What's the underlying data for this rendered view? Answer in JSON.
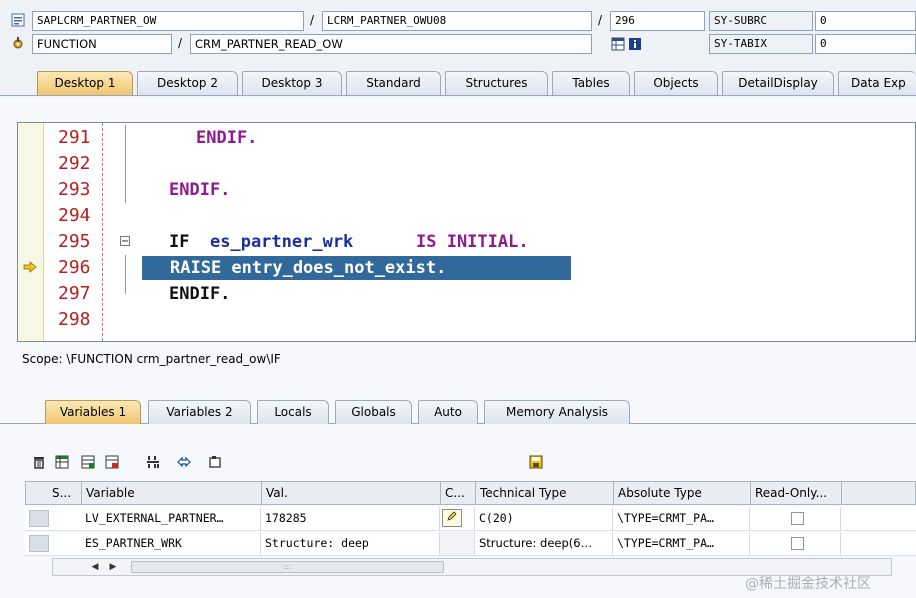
{
  "header": {
    "row1": {
      "program": "SAPLCRM_PARTNER_OW",
      "include": "LCRM_PARTNER_OWU08",
      "line": "296",
      "sy_label": "SY-SUBRC",
      "sy_value": "0"
    },
    "row2": {
      "type": "FUNCTION",
      "name": "CRM_PARTNER_READ_OW",
      "sy_label": "SY-TABIX",
      "sy_value": "0"
    },
    "slash": "/"
  },
  "tabs": [
    "Desktop 1",
    "Desktop 2",
    "Desktop 3",
    "Standard",
    "Structures",
    "Tables",
    "Objects",
    "DetailDisplay",
    "Data Exp"
  ],
  "code": {
    "lines": [
      {
        "num": "291",
        "text": "ENDIF."
      },
      {
        "num": "292",
        "text": ""
      },
      {
        "num": "293",
        "text": "ENDIF."
      },
      {
        "num": "294",
        "text": ""
      },
      {
        "num": "295",
        "kw1": "IF",
        "var": "es_partner_wrk",
        "kw2": "IS INITIAL."
      },
      {
        "num": "296",
        "text": "RAISE entry_does_not_exist."
      },
      {
        "num": "297",
        "text": "ENDIF."
      },
      {
        "num": "298",
        "text": ""
      }
    ]
  },
  "scope": "Scope: \\FUNCTION crm_partner_read_ow\\IF",
  "lower_tabs": [
    "Variables 1",
    "Variables 2",
    "Locals",
    "Globals",
    "Auto",
    "Memory Analysis"
  ],
  "variables": {
    "headers": [
      "S...",
      "Variable",
      "Val.",
      "C...",
      "Technical Type",
      "Absolute Type",
      "Read-Only..."
    ],
    "rows": [
      {
        "variable": "LV_EXTERNAL_PARTNER…",
        "value": "178285",
        "technical_type": "C(20)",
        "absolute_type": "\\TYPE=CRMT_PA…"
      },
      {
        "variable": "ES_PARTNER_WRK",
        "value": "Structure: deep",
        "technical_type": "Structure: deep(6…",
        "absolute_type": "\\TYPE=CRMT_PA…"
      }
    ]
  },
  "watermark": "@稀土掘金技术社区"
}
